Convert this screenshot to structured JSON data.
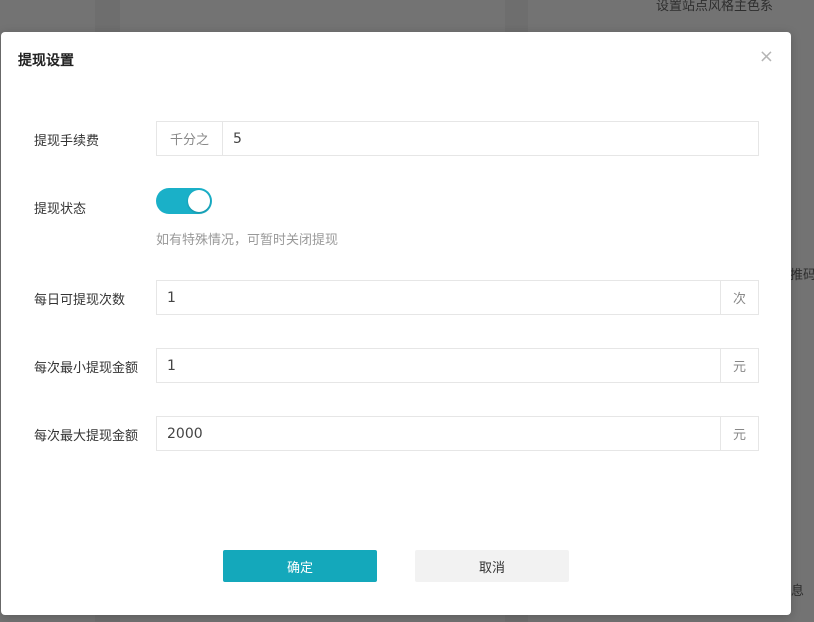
{
  "background": {
    "top_right_text": "设置站点风格主色系",
    "right_side_text": "推码",
    "bottom_right_text": "息"
  },
  "dialog": {
    "title": "提现设置",
    "close_glyph": "×",
    "fee": {
      "label": "提现手续费",
      "prefix": "千分之",
      "value": "5"
    },
    "status": {
      "label": "提现状态",
      "enabled": true,
      "hint": "如有特殊情况，可暂时关闭提现"
    },
    "daily_count": {
      "label": "每日可提现次数",
      "value": "1",
      "suffix": "次"
    },
    "min_amount": {
      "label": "每次最小提现金额",
      "value": "1",
      "suffix": "元"
    },
    "max_amount": {
      "label": "每次最大提现金额",
      "value": "2000",
      "suffix": "元"
    },
    "confirm_label": "确定",
    "cancel_label": "取消"
  },
  "colors": {
    "accent": "#14a8bb",
    "toggle_on": "#1ab0c8",
    "overlay": "#6e6e6e"
  }
}
